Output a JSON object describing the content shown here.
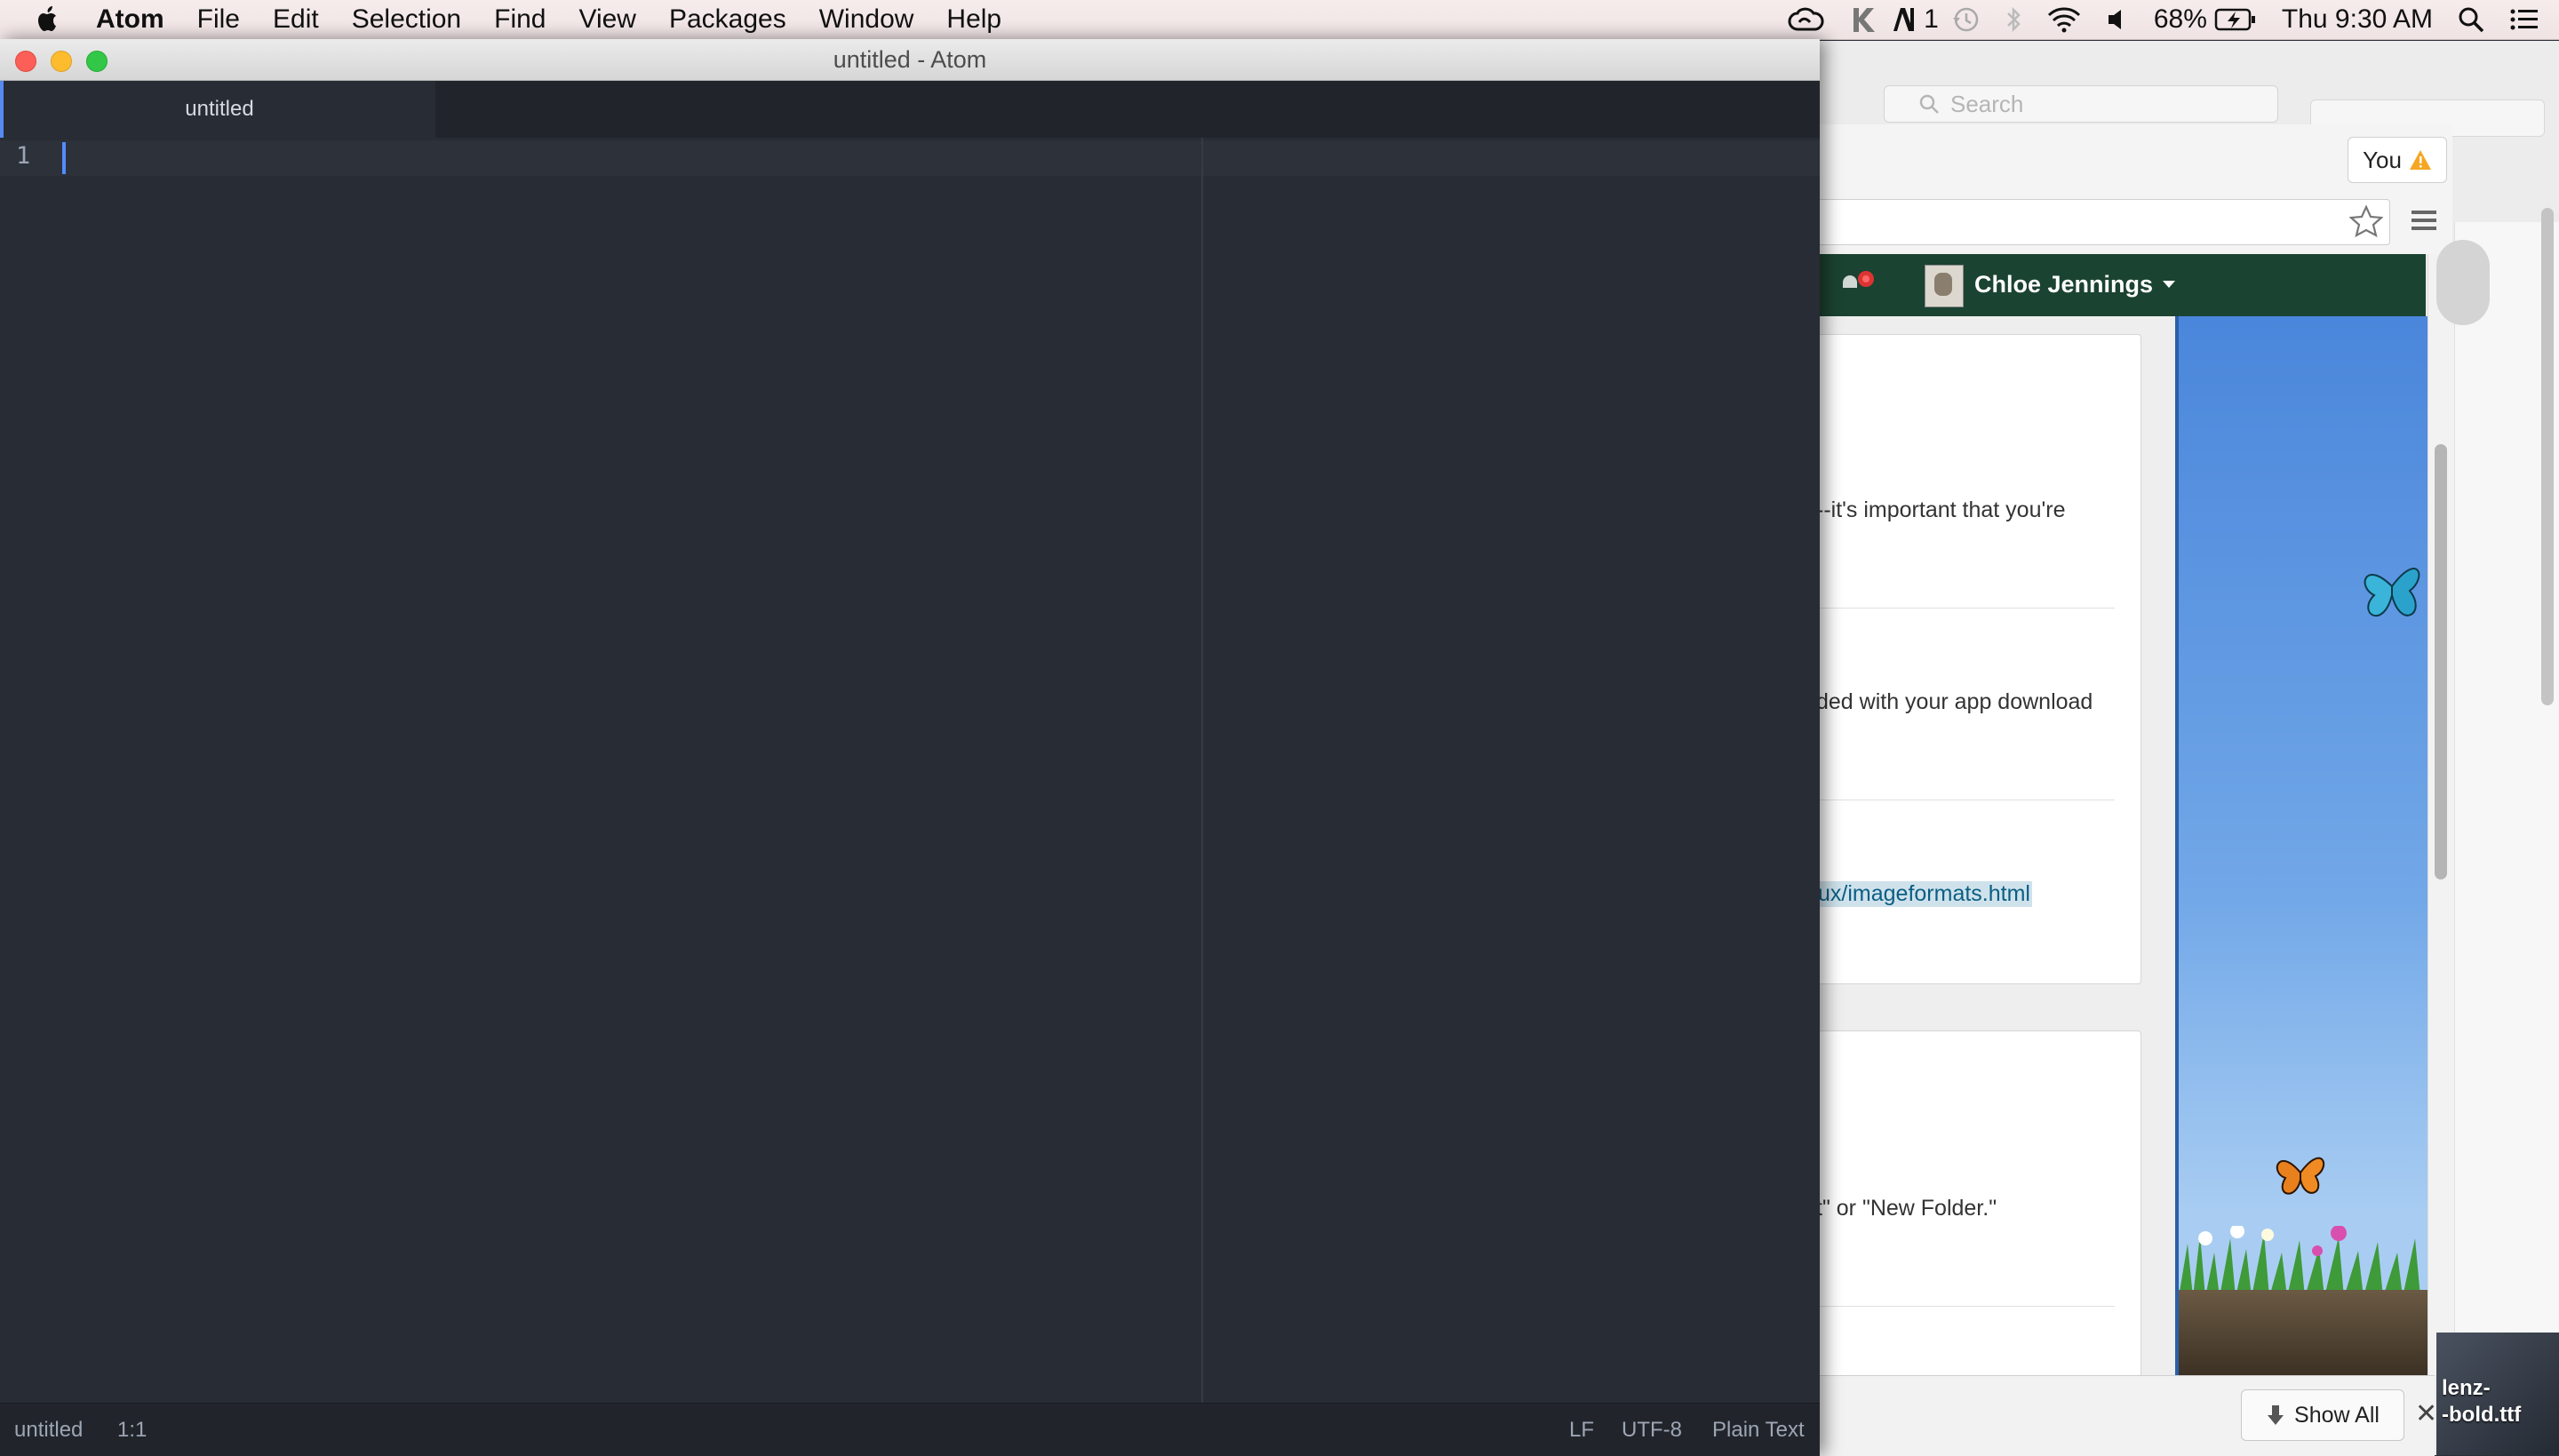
{
  "menubar": {
    "app_name": "Atom",
    "items": [
      "File",
      "Edit",
      "Selection",
      "Find",
      "View",
      "Packages",
      "Window",
      "Help"
    ],
    "status": {
      "notification_count": "1",
      "battery": "68%",
      "clock": "Thu 9:30 AM"
    }
  },
  "atom": {
    "window_title": "untitled - Atom",
    "tab_label": "untitled",
    "line_number": "1",
    "status_bar": {
      "file_name": "untitled",
      "cursor_position": "1:1",
      "line_ending": "LF",
      "encoding": "UTF-8",
      "grammar": "Plain Text"
    }
  },
  "browser": {
    "search_placeholder": "Search",
    "profile_button_label": "You",
    "user_name": "Chloe Jennings",
    "content_lines": [
      "--it's important that you're",
      "ded with your app download",
      "ux/imageformats.html",
      "t\" or \"New Folder.\""
    ],
    "downloads": {
      "show_all_label": "Show All",
      "close_label": "✕"
    },
    "desktop_file_label": [
      "lenz-",
      "-bold.ttf"
    ]
  },
  "colors": {
    "atom_bg": "#282c34",
    "atom_accent": "#528bff",
    "site_header": "#1b4331",
    "link": "#0b5e83"
  },
  "icons": [
    "apple-icon",
    "creative-cloud-icon",
    "k-icon",
    "adobe-icon",
    "time-machine-icon",
    "bluetooth-icon",
    "wifi-icon",
    "volume-icon",
    "battery-charging-icon",
    "spotlight-icon",
    "notification-center-icon",
    "search-icon",
    "warning-icon",
    "star-icon",
    "menu-icon",
    "notification-icon",
    "caret-down-icon",
    "download-icon",
    "close-icon",
    "butterfly-icon"
  ]
}
